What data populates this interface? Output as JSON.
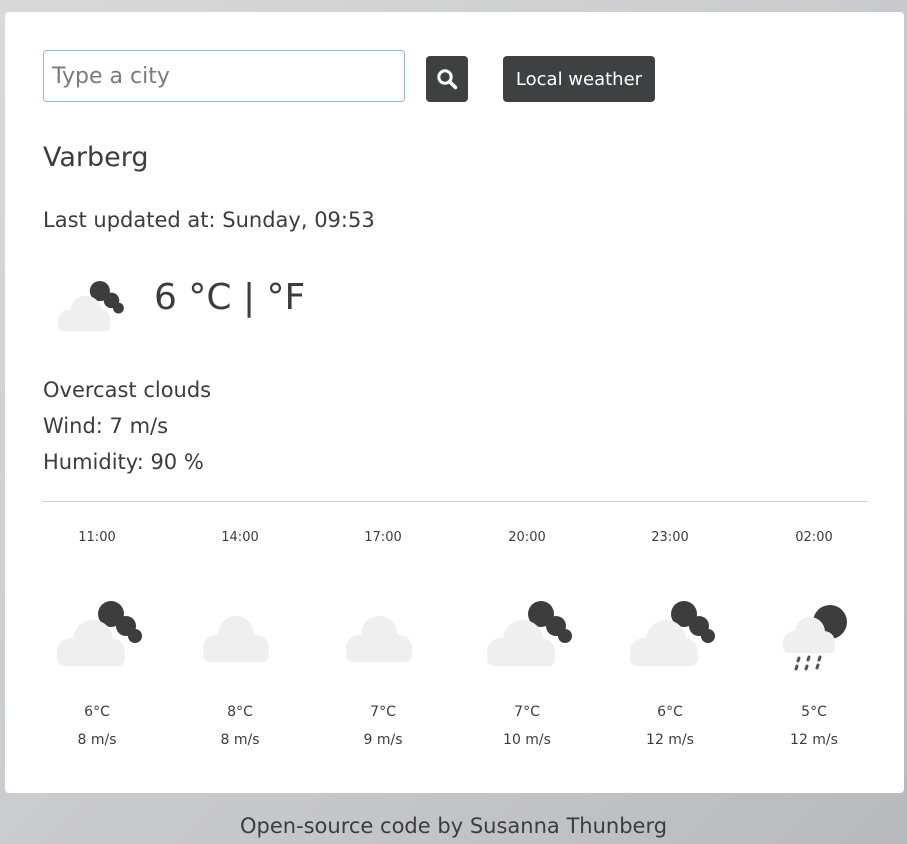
{
  "search": {
    "placeholder": "Type a city",
    "value": ""
  },
  "buttons": {
    "search_icon": "search-icon",
    "local_weather_label": "Local weather"
  },
  "current": {
    "city": "Varberg",
    "last_updated": "Last updated at: Sunday, 09:53",
    "icon": "broken-clouds-icon",
    "temperature": "6",
    "unit_c": "°C",
    "separator": "|",
    "unit_f": "°F",
    "description": "Overcast clouds",
    "wind": "Wind: 7 m/s",
    "humidity": "Humidity: 90 %"
  },
  "forecast": [
    {
      "time": "11:00",
      "icon": "broken-clouds-icon",
      "temp": "6°C",
      "wind": "8 m/s"
    },
    {
      "time": "14:00",
      "icon": "cloud-icon",
      "temp": "8°C",
      "wind": "8 m/s"
    },
    {
      "time": "17:00",
      "icon": "cloud-icon",
      "temp": "7°C",
      "wind": "9 m/s"
    },
    {
      "time": "20:00",
      "icon": "broken-clouds-icon",
      "temp": "7°C",
      "wind": "10 m/s"
    },
    {
      "time": "23:00",
      "icon": "broken-clouds-icon",
      "temp": "6°C",
      "wind": "12 m/s"
    },
    {
      "time": "02:00",
      "icon": "rain-icon",
      "temp": "5°C",
      "wind": "12 m/s"
    }
  ],
  "footer": {
    "prefix": "Open-source code",
    "by": "by",
    "author": "Susanna Thunberg"
  },
  "colors": {
    "button_bg": "#3f4042",
    "cloud_light": "#efefef",
    "cloud_dark": "#3d3d3d",
    "text": "#3c3c3c",
    "input_border": "#93b8e3"
  }
}
